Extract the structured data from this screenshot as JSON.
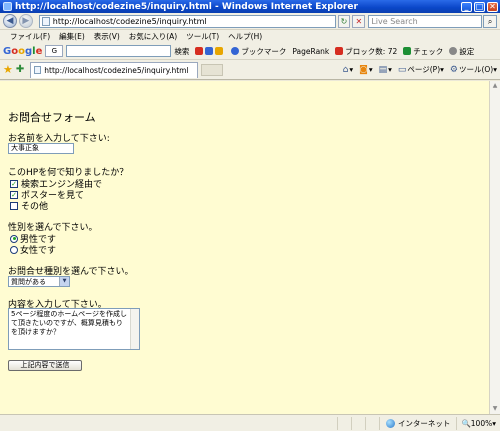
{
  "window": {
    "title": "http://localhost/codezine5/inquiry.html - Windows Internet Explorer"
  },
  "address": {
    "url": "http://localhost/codezine5/inquiry.html",
    "search_placeholder": "Live Search"
  },
  "menu": [
    "ファイル(F)",
    "編集(E)",
    "表示(V)",
    "お気に入り(A)",
    "ツール(T)",
    "ヘルプ(H)"
  ],
  "google_toolbar": {
    "logo": {
      "b1": "G",
      "r1": "o",
      "y": "o",
      "b2": "g",
      "g": "l",
      "r2": "e"
    },
    "engine": "G",
    "search_label": "検索",
    "bookmarks_label": "ブックマーク",
    "pagerank_label": "PageRank",
    "popup_label": "ブロック数: 72",
    "check_label": "チェック",
    "settings_label": "設定"
  },
  "tab": {
    "title": "http://localhost/codezine5/inquiry.html"
  },
  "commands": {
    "page_label": "ページ(P)",
    "tools_label": "ツール(O)"
  },
  "form": {
    "title": "お問合せフォーム",
    "name_label": "お名前を入力して下さい:",
    "name_value": "大事正象",
    "source_label": "このHPを何で知りましたか？",
    "source_options": [
      {
        "label": "検索エンジン経由で",
        "checked": true
      },
      {
        "label": "ポスターを見て",
        "checked": true
      },
      {
        "label": "その他",
        "checked": false
      }
    ],
    "gender_label": "性別を選んで下さい。",
    "gender_options": [
      {
        "label": "男性です",
        "checked": true
      },
      {
        "label": "女性です",
        "checked": false
      }
    ],
    "type_label": "お問合せ種別を選んで下さい。",
    "type_value": "質問がある",
    "content_label": "内容を入力して下さい。",
    "content_value": "5ページ程度のホームページを作成して頂きたいのですが、概算見積もりを頂けますか？",
    "submit_label": "上記内容で送信"
  },
  "status": {
    "zone": "インターネット",
    "zoom": "100%"
  }
}
